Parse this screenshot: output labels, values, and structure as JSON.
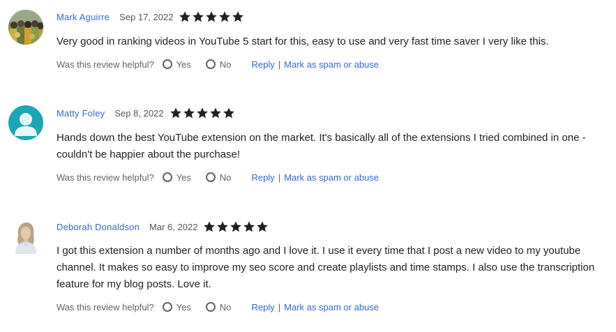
{
  "common": {
    "helpful_prompt": "Was this review helpful?",
    "yes_label": "Yes",
    "no_label": "No",
    "reply_label": "Reply",
    "separator": "|",
    "spam_label": "Mark as spam or abuse",
    "star_color": "#202124",
    "link_color": "#3367d6"
  },
  "reviews": [
    {
      "author": "Mark Aguirre",
      "date": "Sep 17, 2022",
      "rating": 5,
      "avatar": "group-photo-avatar",
      "text": "Very good in ranking videos in YouTube 5 start for this, easy to use and very fast time saver I very like this."
    },
    {
      "author": "Matty Foley",
      "date": "Sep 8, 2022",
      "rating": 5,
      "avatar": "default-person-avatar",
      "text": "Hands down the best YouTube extension on the market. It's basically all of the extensions I tried combined in one - couldn't be happier about the purchase!"
    },
    {
      "author": "Deborah Donaldson",
      "date": "Mar 6, 2022",
      "rating": 5,
      "avatar": "woman-portrait-avatar",
      "text": "I got this extension a number of months ago and I love it.  I use it every time that I post a new video to my youtube channel.  It makes so easy to improve my seo score and create playlists and time stamps. I also use the transcription feature for my blog posts.  Love it."
    }
  ]
}
